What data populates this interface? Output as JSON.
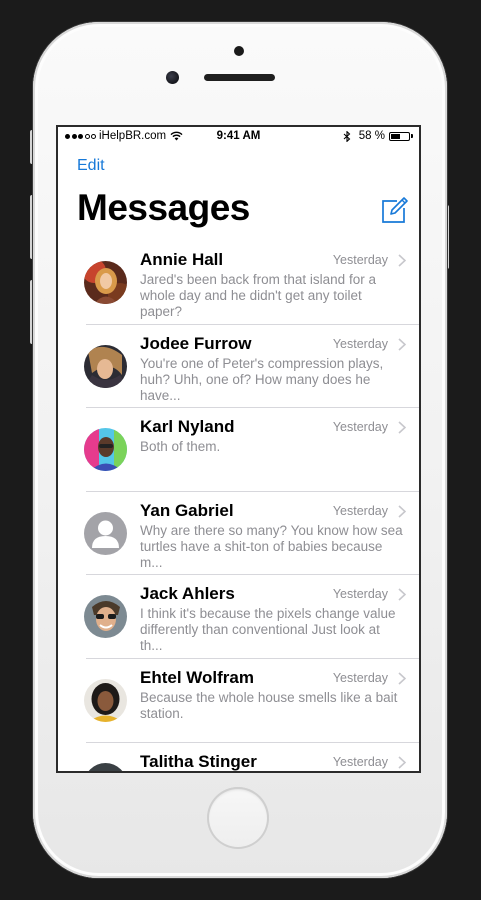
{
  "status_bar": {
    "carrier": "iHelpBR.com",
    "time": "9:41 AM",
    "battery_percent": "58 %",
    "battery_level": 0.58
  },
  "nav": {
    "edit_label": "Edit",
    "title": "Messages",
    "compose_icon": "compose-icon"
  },
  "colors": {
    "accent": "#1779d8",
    "secondary_text": "#8e8e93",
    "separator": "#d7d7dc"
  },
  "messages": [
    {
      "sender": "Annie Hall",
      "time": "Yesterday",
      "preview": "Jared's been back from that island for a whole day and he didn't get any toilet paper?"
    },
    {
      "sender": "Jodee Furrow",
      "time": "Yesterday",
      "preview": "You're one of Peter's compression plays, huh? Uhh, one of? How many does he have..."
    },
    {
      "sender": "Karl Nyland",
      "time": "Yesterday",
      "preview": "Both of them."
    },
    {
      "sender": "Yan Gabriel",
      "time": "Yesterday",
      "preview": "Why are there so many? You know how sea turtles have a shit-ton of babies because m..."
    },
    {
      "sender": "Jack Ahlers",
      "time": "Yesterday",
      "preview": "I think it's because the pixels change value differently than conventional Just look at th..."
    },
    {
      "sender": "Ehtel Wolfram",
      "time": "Yesterday",
      "preview": "Because the whole house smells like a bait station."
    },
    {
      "sender": "Talitha Stinger",
      "time": "Yesterday",
      "preview": ""
    }
  ]
}
